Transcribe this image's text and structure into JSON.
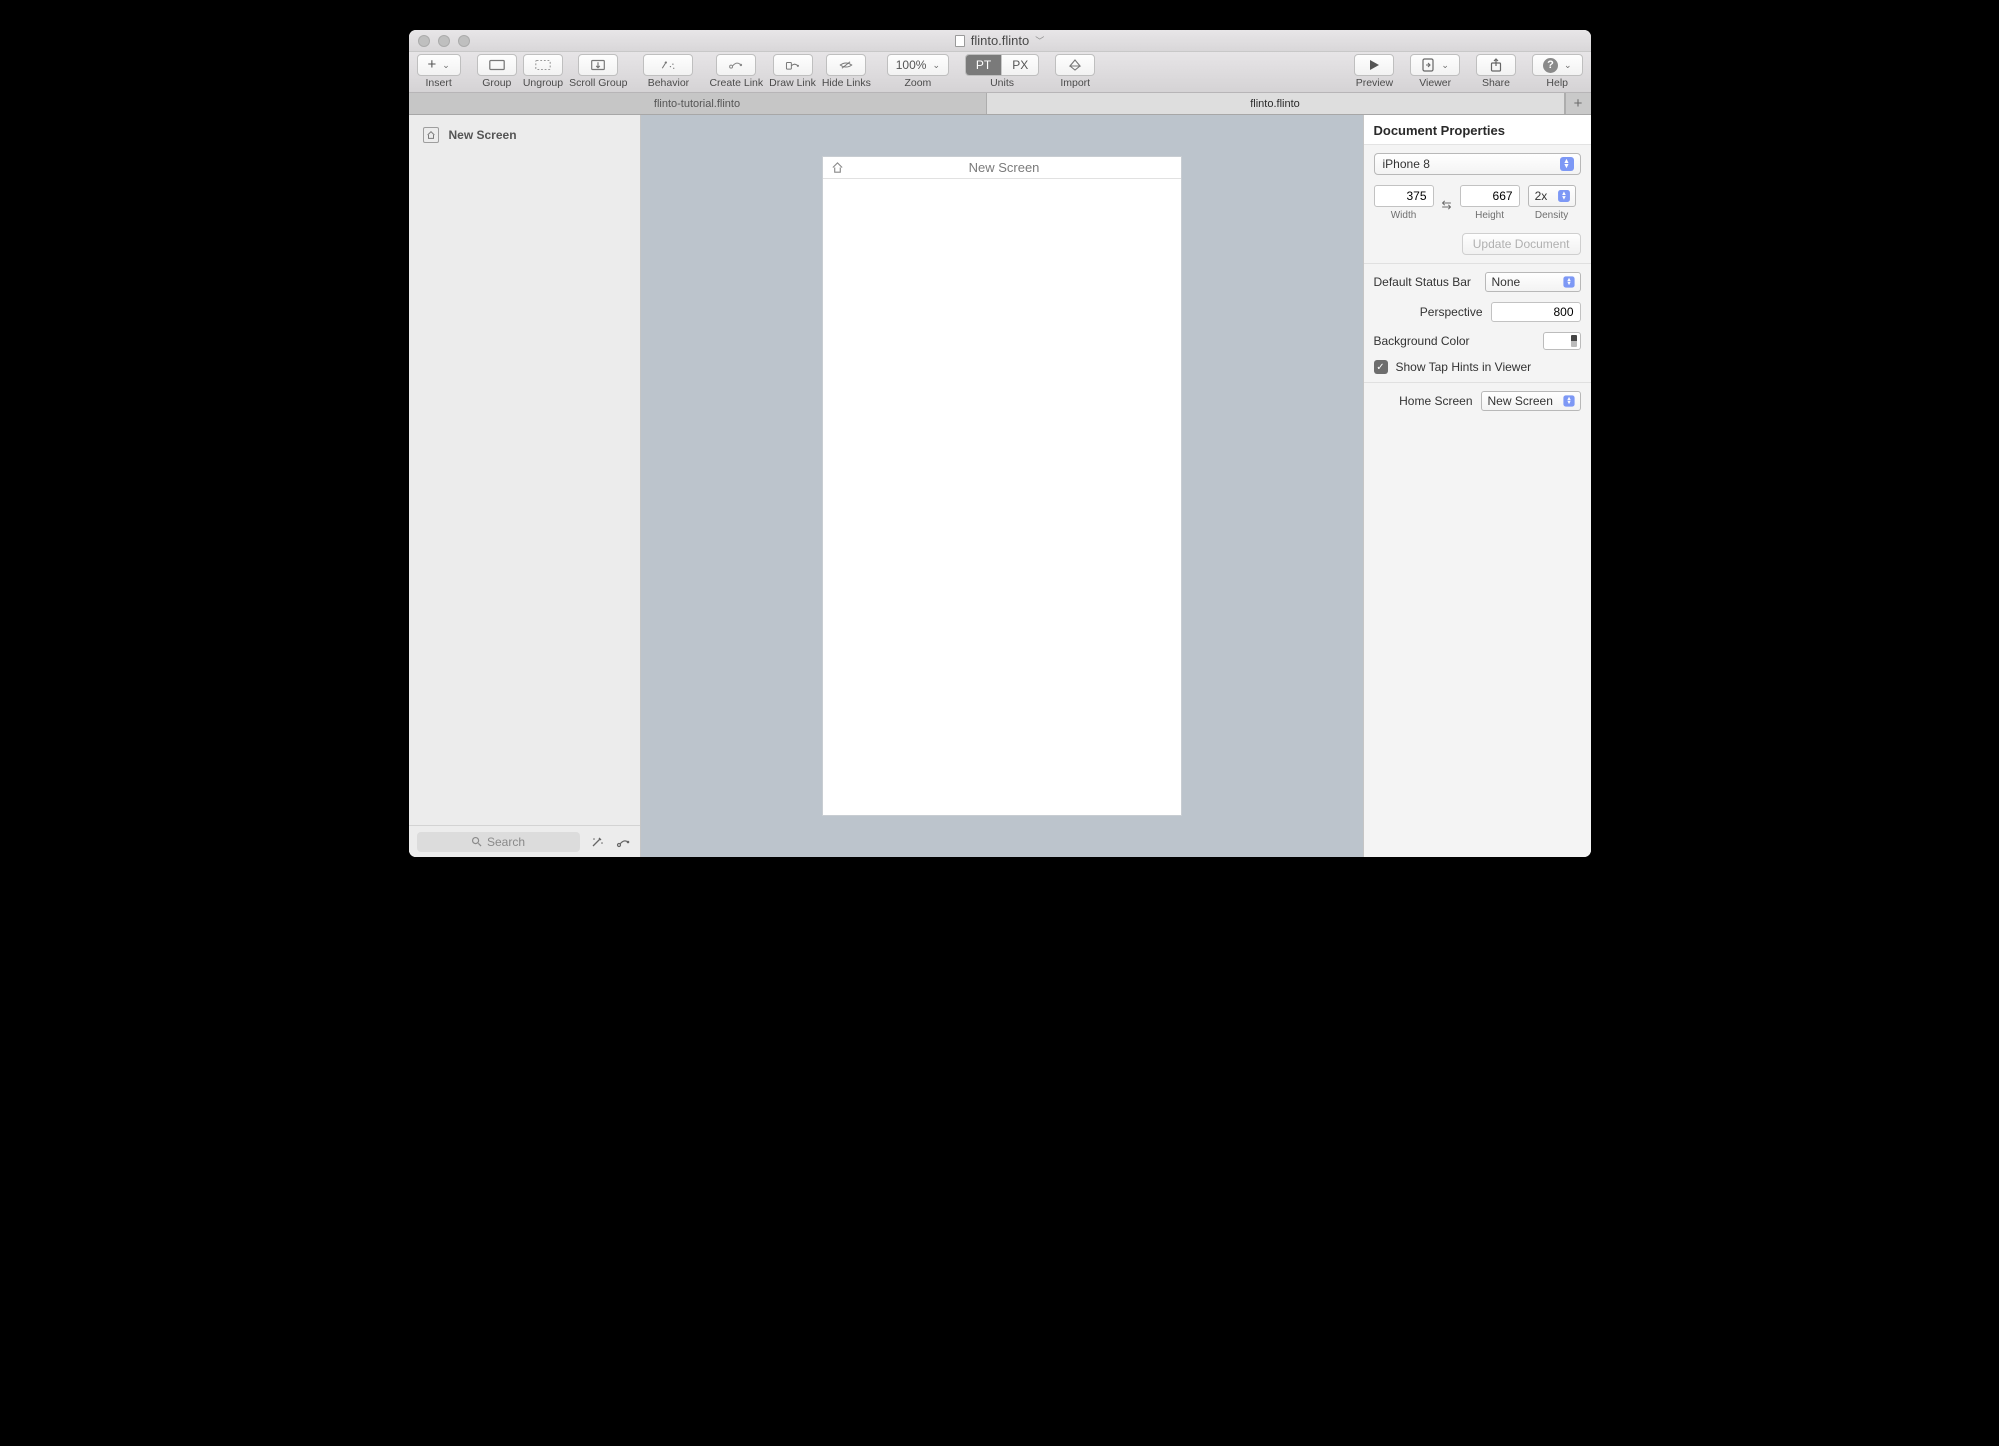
{
  "window": {
    "title": "flinto.flinto"
  },
  "toolbar": {
    "insert": "Insert",
    "group": "Group",
    "ungroup": "Ungroup",
    "scroll_group": "Scroll Group",
    "behavior": "Behavior",
    "create_link": "Create Link",
    "draw_link": "Draw Link",
    "hide_links": "Hide Links",
    "zoom_label": "Zoom",
    "zoom_value": "100%",
    "units_label": "Units",
    "units_pt": "PT",
    "units_px": "PX",
    "import": "Import",
    "preview": "Preview",
    "viewer": "Viewer",
    "share": "Share",
    "help": "Help"
  },
  "tabs": {
    "a": "flinto-tutorial.flinto",
    "b": "flinto.flinto"
  },
  "sidebar": {
    "items": [
      {
        "label": "New Screen"
      }
    ],
    "search_placeholder": "Search"
  },
  "canvas": {
    "artboard_title": "New Screen"
  },
  "inspector": {
    "title": "Document Properties",
    "device": "iPhone 8",
    "width": "375",
    "height": "667",
    "density": "2x",
    "width_label": "Width",
    "height_label": "Height",
    "density_label": "Density",
    "update_btn": "Update Document",
    "status_bar_label": "Default Status Bar",
    "status_bar_value": "None",
    "perspective_label": "Perspective",
    "perspective_value": "800",
    "bgcolor_label": "Background Color",
    "tap_hints_label": "Show Tap Hints in Viewer",
    "home_screen_label": "Home Screen",
    "home_screen_value": "New Screen"
  }
}
